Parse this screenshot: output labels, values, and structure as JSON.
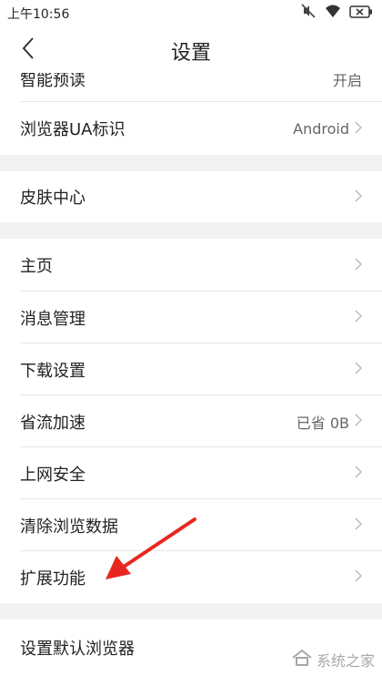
{
  "status_bar": {
    "time": "上午10:56",
    "icons": [
      "mute-icon",
      "wifi-icon",
      "battery-icon"
    ]
  },
  "header": {
    "title": "设置",
    "back_icon": "chevron-left-icon"
  },
  "sections": {
    "top": [
      {
        "label": "智能预读",
        "value": "开启"
      },
      {
        "label": "浏览器UA标识",
        "value": "Android"
      }
    ],
    "skin": [
      {
        "label": "皮肤中心",
        "value": ""
      }
    ],
    "main": [
      {
        "label": "主页",
        "value": ""
      },
      {
        "label": "消息管理",
        "value": ""
      },
      {
        "label": "下载设置",
        "value": ""
      },
      {
        "label": "省流加速",
        "value": "已省 0B"
      },
      {
        "label": "上网安全",
        "value": ""
      },
      {
        "label": "清除浏览数据",
        "value": ""
      },
      {
        "label": "扩展功能",
        "value": ""
      }
    ],
    "bottom": [
      {
        "label": "设置默认浏览器",
        "value": ""
      }
    ]
  },
  "annotation": {
    "color": "#e8261f"
  },
  "watermark": {
    "text": "系统之家"
  },
  "colors": {
    "background": "#f2f2f2",
    "row_bg": "#ffffff",
    "chevron": "#bbbbbb"
  }
}
